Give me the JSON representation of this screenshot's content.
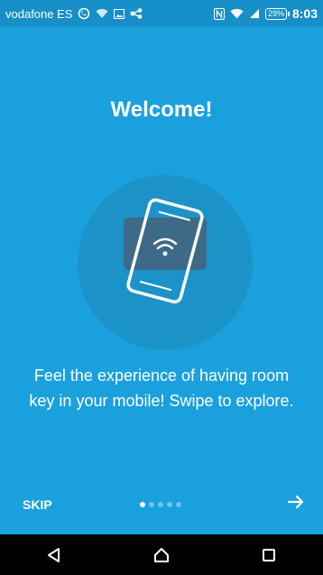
{
  "status_bar": {
    "carrier": "vodafone ES",
    "battery": "29%",
    "time": "8:03",
    "icons": [
      "whatsapp-icon",
      "wifi-icon",
      "gallery-icon",
      "share-icon",
      "nfc-icon",
      "wifi-signal-icon",
      "cell-signal-icon",
      "battery-icon"
    ]
  },
  "onboarding": {
    "title": "Welcome!",
    "description": "Feel the experience of having room key in your mobile! Swipe to explore.",
    "hero_icon": "phone-wifi-key-icon",
    "skip_label": "SKIP",
    "next_icon": "arrow-right-icon",
    "page_count": 5,
    "current_page": 1
  },
  "colors": {
    "background": "#1aa0dd",
    "status_bar": "#178fc9",
    "hero_circle": "#1c93c8",
    "card": "#3d6a86",
    "text": "#ffffff"
  },
  "system_nav": {
    "back_icon": "back-triangle-icon",
    "home_icon": "home-icon",
    "recents_icon": "recents-square-icon"
  }
}
